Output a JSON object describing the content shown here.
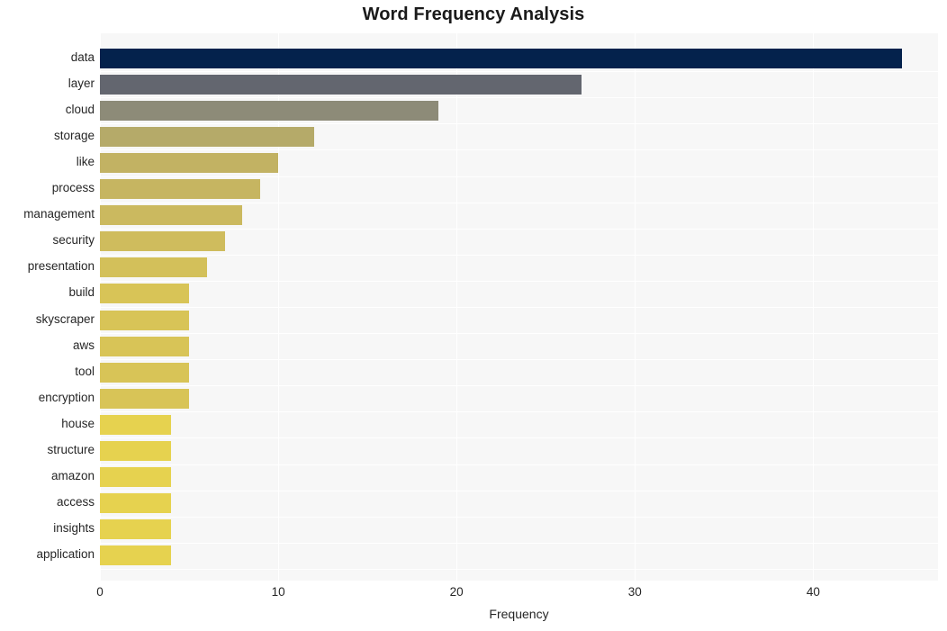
{
  "chart_data": {
    "type": "bar",
    "orientation": "horizontal",
    "title": "Word Frequency Analysis",
    "xlabel": "Frequency",
    "ylabel": "",
    "categories": [
      "data",
      "layer",
      "cloud",
      "storage",
      "like",
      "process",
      "management",
      "security",
      "presentation",
      "build",
      "skyscraper",
      "aws",
      "tool",
      "encryption",
      "house",
      "structure",
      "amazon",
      "access",
      "insights",
      "application"
    ],
    "values": [
      45,
      27,
      19,
      12,
      10,
      9,
      8,
      7,
      6,
      5,
      5,
      5,
      5,
      5,
      4,
      4,
      4,
      4,
      4,
      4
    ],
    "xlim": [
      0,
      47
    ],
    "xticks": [
      0,
      10,
      20,
      30,
      40
    ],
    "xtick_labels": [
      "0",
      "10",
      "20",
      "30",
      "40"
    ],
    "grid": true,
    "legend": null,
    "bar_colors": [
      "#04224c",
      "#63666f",
      "#8d8b78",
      "#b5aa69",
      "#c2b263",
      "#c6b561",
      "#cbb95f",
      "#cfbc5d",
      "#d3c05a",
      "#d8c457",
      "#d8c457",
      "#d8c457",
      "#d8c457",
      "#d8c457",
      "#e6d24f",
      "#e6d24f",
      "#e6d24f",
      "#e6d24f",
      "#e6d24f",
      "#e6d24f"
    ],
    "plot_background": "#f7f7f7",
    "grid_color": "#ffffff",
    "figure_background": "#ffffff",
    "text_color": "#262626",
    "title_color": "#1a1a1a"
  }
}
